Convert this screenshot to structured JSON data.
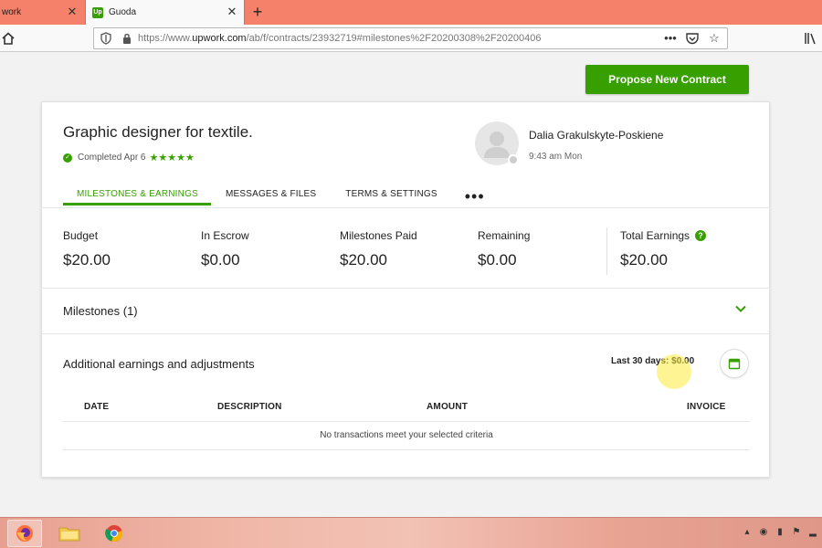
{
  "browser": {
    "tabs": [
      {
        "title": "work",
        "active": false
      },
      {
        "title": "Guoda",
        "active": true,
        "favicon": "Up"
      }
    ],
    "new_tab_label": "+",
    "url_prefix": "https://www.",
    "url_domain": "upwork.com",
    "url_rest": "/ab/f/contracts/23932719#milestones%2F20200308%2F20200406",
    "page_actions_label": "•••"
  },
  "page": {
    "propose_button": "Propose New Contract",
    "contract": {
      "title": "Graphic designer for textile.",
      "status": "Completed Apr 6",
      "stars": "★★★★★",
      "rating": 5
    },
    "freelancer": {
      "name": "Dalia Grakulskyte-Poskiene",
      "local_time": "9:43 am Mon"
    },
    "tabs": [
      "MILESTONES & EARNINGS",
      "MESSAGES & FILES",
      "TERMS & SETTINGS"
    ],
    "more_label": "•••",
    "stats": [
      {
        "label": "Budget",
        "value": "$20.00"
      },
      {
        "label": "In Escrow",
        "value": "$0.00"
      },
      {
        "label": "Milestones Paid",
        "value": "$20.00"
      },
      {
        "label": "Remaining",
        "value": "$0.00"
      },
      {
        "label": "Total Earnings",
        "value": "$20.00"
      }
    ],
    "help_label": "?",
    "milestones_label": "Milestones (1)",
    "adjustments": {
      "title": "Additional earnings and adjustments",
      "last30": "Last 30 days: $0.00",
      "columns": [
        "DATE",
        "DESCRIPTION",
        "AMOUNT",
        "INVOICE"
      ],
      "empty_message": "No transactions meet your selected criteria"
    }
  },
  "colors": {
    "accent": "#37a000",
    "tabstrip": "#f5816b"
  }
}
